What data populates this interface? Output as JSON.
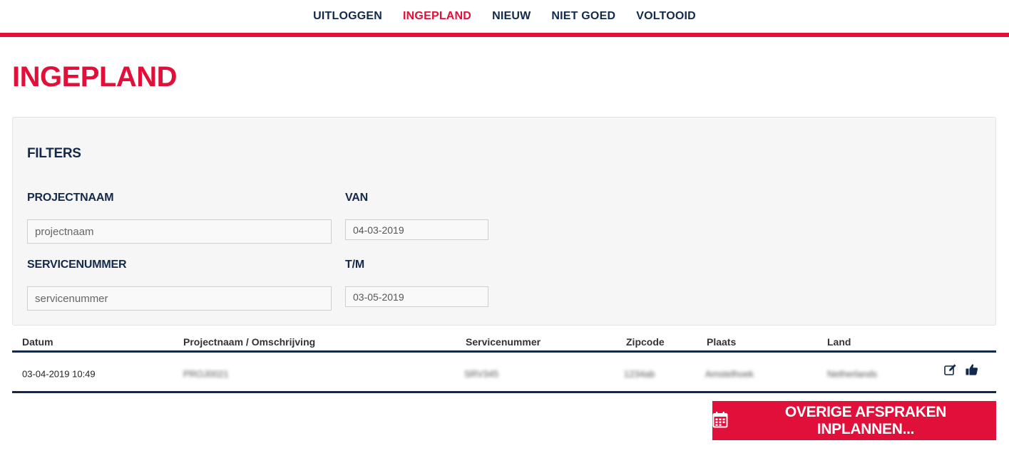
{
  "nav": {
    "items": [
      {
        "label": "UITLOGGEN"
      },
      {
        "label": "INGEPLAND"
      },
      {
        "label": "NIEUW"
      },
      {
        "label": "NIET GOED"
      },
      {
        "label": "VOLTOOID"
      }
    ],
    "active": "INGEPLAND"
  },
  "page": {
    "title": "INGEPLAND"
  },
  "filters": {
    "title": "FILTERS",
    "projectnaam": {
      "label": "PROJECTNAAM",
      "placeholder": "projectnaam",
      "value": ""
    },
    "servicenummer": {
      "label": "SERVICENUMMER",
      "placeholder": "servicenummer",
      "value": ""
    },
    "van": {
      "label": "VAN",
      "value": "04-03-2019"
    },
    "tm": {
      "label": "T/M",
      "value": "03-05-2019"
    }
  },
  "table": {
    "headers": [
      "Datum",
      "Projectnaam / Omschrijving",
      "Servicenummer",
      "Zipcode",
      "Plaats",
      "Land"
    ],
    "rows": [
      {
        "datum": "03-04-2019 10:49",
        "projectnaam": "PROJ0021",
        "servicenummer": "SRV345",
        "zipcode": "1234ab",
        "plaats": "Amstelhoek",
        "land": "Netherlands"
      }
    ]
  },
  "cta": {
    "label": "OVERIGE AFSPRAKEN INPLANNEN...",
    "icon": "calendar-icon"
  },
  "colors": {
    "accent": "#e0103a",
    "navy": "#13294b"
  }
}
